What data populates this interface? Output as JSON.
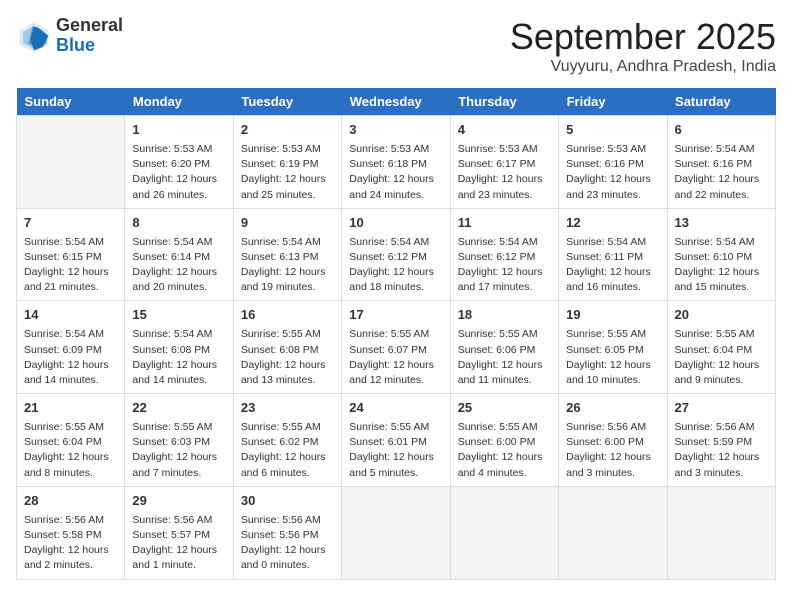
{
  "header": {
    "logo_general": "General",
    "logo_blue": "Blue",
    "month_title": "September 2025",
    "location": "Vuyyuru, Andhra Pradesh, India"
  },
  "weekdays": [
    "Sunday",
    "Monday",
    "Tuesday",
    "Wednesday",
    "Thursday",
    "Friday",
    "Saturday"
  ],
  "weeks": [
    [
      {
        "num": "",
        "info": ""
      },
      {
        "num": "1",
        "info": "Sunrise: 5:53 AM\nSunset: 6:20 PM\nDaylight: 12 hours\nand 26 minutes."
      },
      {
        "num": "2",
        "info": "Sunrise: 5:53 AM\nSunset: 6:19 PM\nDaylight: 12 hours\nand 25 minutes."
      },
      {
        "num": "3",
        "info": "Sunrise: 5:53 AM\nSunset: 6:18 PM\nDaylight: 12 hours\nand 24 minutes."
      },
      {
        "num": "4",
        "info": "Sunrise: 5:53 AM\nSunset: 6:17 PM\nDaylight: 12 hours\nand 23 minutes."
      },
      {
        "num": "5",
        "info": "Sunrise: 5:53 AM\nSunset: 6:16 PM\nDaylight: 12 hours\nand 23 minutes."
      },
      {
        "num": "6",
        "info": "Sunrise: 5:54 AM\nSunset: 6:16 PM\nDaylight: 12 hours\nand 22 minutes."
      }
    ],
    [
      {
        "num": "7",
        "info": "Sunrise: 5:54 AM\nSunset: 6:15 PM\nDaylight: 12 hours\nand 21 minutes."
      },
      {
        "num": "8",
        "info": "Sunrise: 5:54 AM\nSunset: 6:14 PM\nDaylight: 12 hours\nand 20 minutes."
      },
      {
        "num": "9",
        "info": "Sunrise: 5:54 AM\nSunset: 6:13 PM\nDaylight: 12 hours\nand 19 minutes."
      },
      {
        "num": "10",
        "info": "Sunrise: 5:54 AM\nSunset: 6:12 PM\nDaylight: 12 hours\nand 18 minutes."
      },
      {
        "num": "11",
        "info": "Sunrise: 5:54 AM\nSunset: 6:12 PM\nDaylight: 12 hours\nand 17 minutes."
      },
      {
        "num": "12",
        "info": "Sunrise: 5:54 AM\nSunset: 6:11 PM\nDaylight: 12 hours\nand 16 minutes."
      },
      {
        "num": "13",
        "info": "Sunrise: 5:54 AM\nSunset: 6:10 PM\nDaylight: 12 hours\nand 15 minutes."
      }
    ],
    [
      {
        "num": "14",
        "info": "Sunrise: 5:54 AM\nSunset: 6:09 PM\nDaylight: 12 hours\nand 14 minutes."
      },
      {
        "num": "15",
        "info": "Sunrise: 5:54 AM\nSunset: 6:08 PM\nDaylight: 12 hours\nand 14 minutes."
      },
      {
        "num": "16",
        "info": "Sunrise: 5:55 AM\nSunset: 6:08 PM\nDaylight: 12 hours\nand 13 minutes."
      },
      {
        "num": "17",
        "info": "Sunrise: 5:55 AM\nSunset: 6:07 PM\nDaylight: 12 hours\nand 12 minutes."
      },
      {
        "num": "18",
        "info": "Sunrise: 5:55 AM\nSunset: 6:06 PM\nDaylight: 12 hours\nand 11 minutes."
      },
      {
        "num": "19",
        "info": "Sunrise: 5:55 AM\nSunset: 6:05 PM\nDaylight: 12 hours\nand 10 minutes."
      },
      {
        "num": "20",
        "info": "Sunrise: 5:55 AM\nSunset: 6:04 PM\nDaylight: 12 hours\nand 9 minutes."
      }
    ],
    [
      {
        "num": "21",
        "info": "Sunrise: 5:55 AM\nSunset: 6:04 PM\nDaylight: 12 hours\nand 8 minutes."
      },
      {
        "num": "22",
        "info": "Sunrise: 5:55 AM\nSunset: 6:03 PM\nDaylight: 12 hours\nand 7 minutes."
      },
      {
        "num": "23",
        "info": "Sunrise: 5:55 AM\nSunset: 6:02 PM\nDaylight: 12 hours\nand 6 minutes."
      },
      {
        "num": "24",
        "info": "Sunrise: 5:55 AM\nSunset: 6:01 PM\nDaylight: 12 hours\nand 5 minutes."
      },
      {
        "num": "25",
        "info": "Sunrise: 5:55 AM\nSunset: 6:00 PM\nDaylight: 12 hours\nand 4 minutes."
      },
      {
        "num": "26",
        "info": "Sunrise: 5:56 AM\nSunset: 6:00 PM\nDaylight: 12 hours\nand 3 minutes."
      },
      {
        "num": "27",
        "info": "Sunrise: 5:56 AM\nSunset: 5:59 PM\nDaylight: 12 hours\nand 3 minutes."
      }
    ],
    [
      {
        "num": "28",
        "info": "Sunrise: 5:56 AM\nSunset: 5:58 PM\nDaylight: 12 hours\nand 2 minutes."
      },
      {
        "num": "29",
        "info": "Sunrise: 5:56 AM\nSunset: 5:57 PM\nDaylight: 12 hours\nand 1 minute."
      },
      {
        "num": "30",
        "info": "Sunrise: 5:56 AM\nSunset: 5:56 PM\nDaylight: 12 hours\nand 0 minutes."
      },
      {
        "num": "",
        "info": ""
      },
      {
        "num": "",
        "info": ""
      },
      {
        "num": "",
        "info": ""
      },
      {
        "num": "",
        "info": ""
      }
    ]
  ]
}
